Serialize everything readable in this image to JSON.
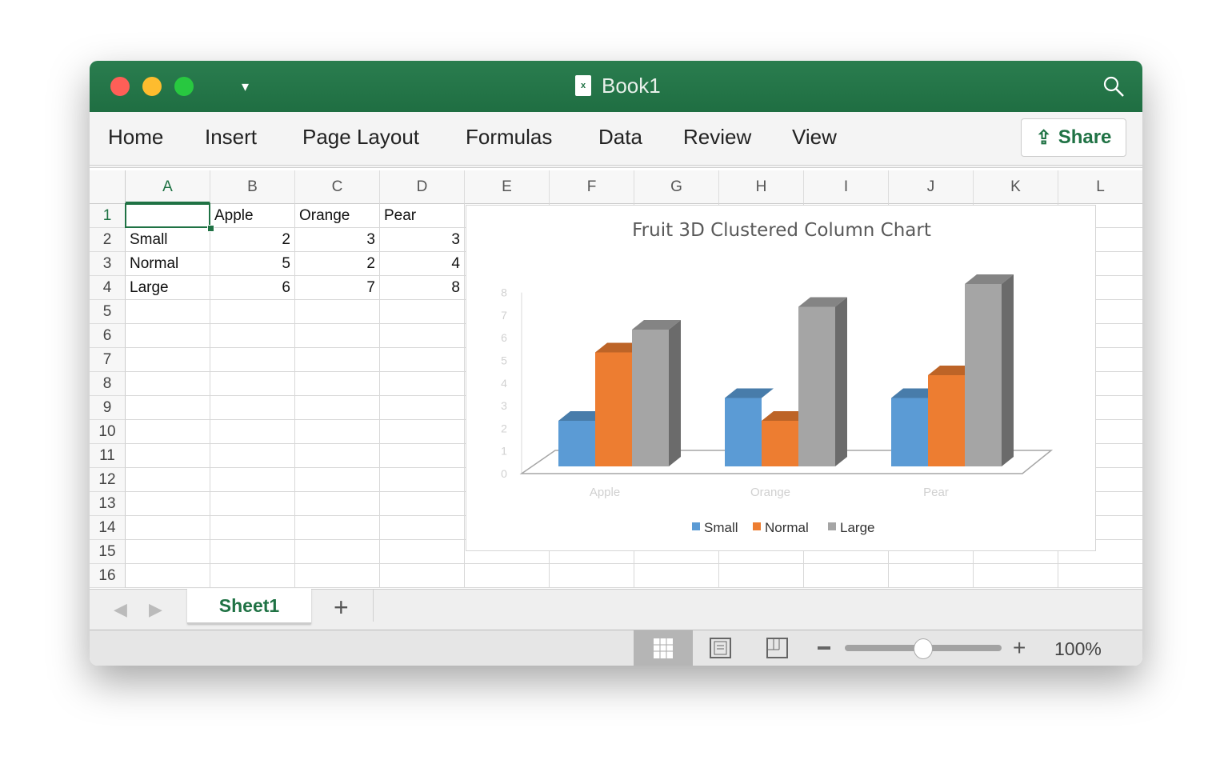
{
  "window": {
    "title": "Book1",
    "colors": {
      "titlebar": "#217346",
      "accent": "#1f7244"
    }
  },
  "ribbon": {
    "tabs": [
      "Home",
      "Insert",
      "Page Layout",
      "Formulas",
      "Data",
      "Review",
      "View"
    ],
    "share_label": "Share"
  },
  "sheet": {
    "columns": [
      "A",
      "B",
      "C",
      "D",
      "E",
      "F",
      "G",
      "H",
      "I",
      "J",
      "K",
      "L"
    ],
    "rows": [
      "1",
      "2",
      "3",
      "4",
      "5",
      "6",
      "7",
      "8",
      "9",
      "10",
      "11",
      "12",
      "13",
      "14",
      "15",
      "16"
    ],
    "selected_cell": "A1",
    "cells": [
      [
        "",
        "Apple",
        "Orange",
        "Pear"
      ],
      [
        "Small",
        "2",
        "3",
        "3"
      ],
      [
        "Normal",
        "5",
        "2",
        "4"
      ],
      [
        "Large",
        "6",
        "7",
        "8"
      ]
    ]
  },
  "sheet_tabs": {
    "active": "Sheet1"
  },
  "status": {
    "zoom": "100%",
    "zoom_level": 0.5
  },
  "chart_data": {
    "type": "bar",
    "title": "Fruit 3D Clustered Column Chart",
    "categories": [
      "Apple",
      "Orange",
      "Pear"
    ],
    "series": [
      {
        "name": "Small",
        "values": [
          2,
          3,
          3
        ],
        "color": "#5b9bd5"
      },
      {
        "name": "Normal",
        "values": [
          5,
          2,
          4
        ],
        "color": "#ed7d31"
      },
      {
        "name": "Large",
        "values": [
          6,
          7,
          8
        ],
        "color": "#a5a5a5"
      }
    ],
    "ylim": [
      0,
      8
    ],
    "yticks": [
      "0",
      "1",
      "2",
      "3",
      "4",
      "5",
      "6",
      "7",
      "8"
    ],
    "legend": "bottom",
    "grid": false
  }
}
